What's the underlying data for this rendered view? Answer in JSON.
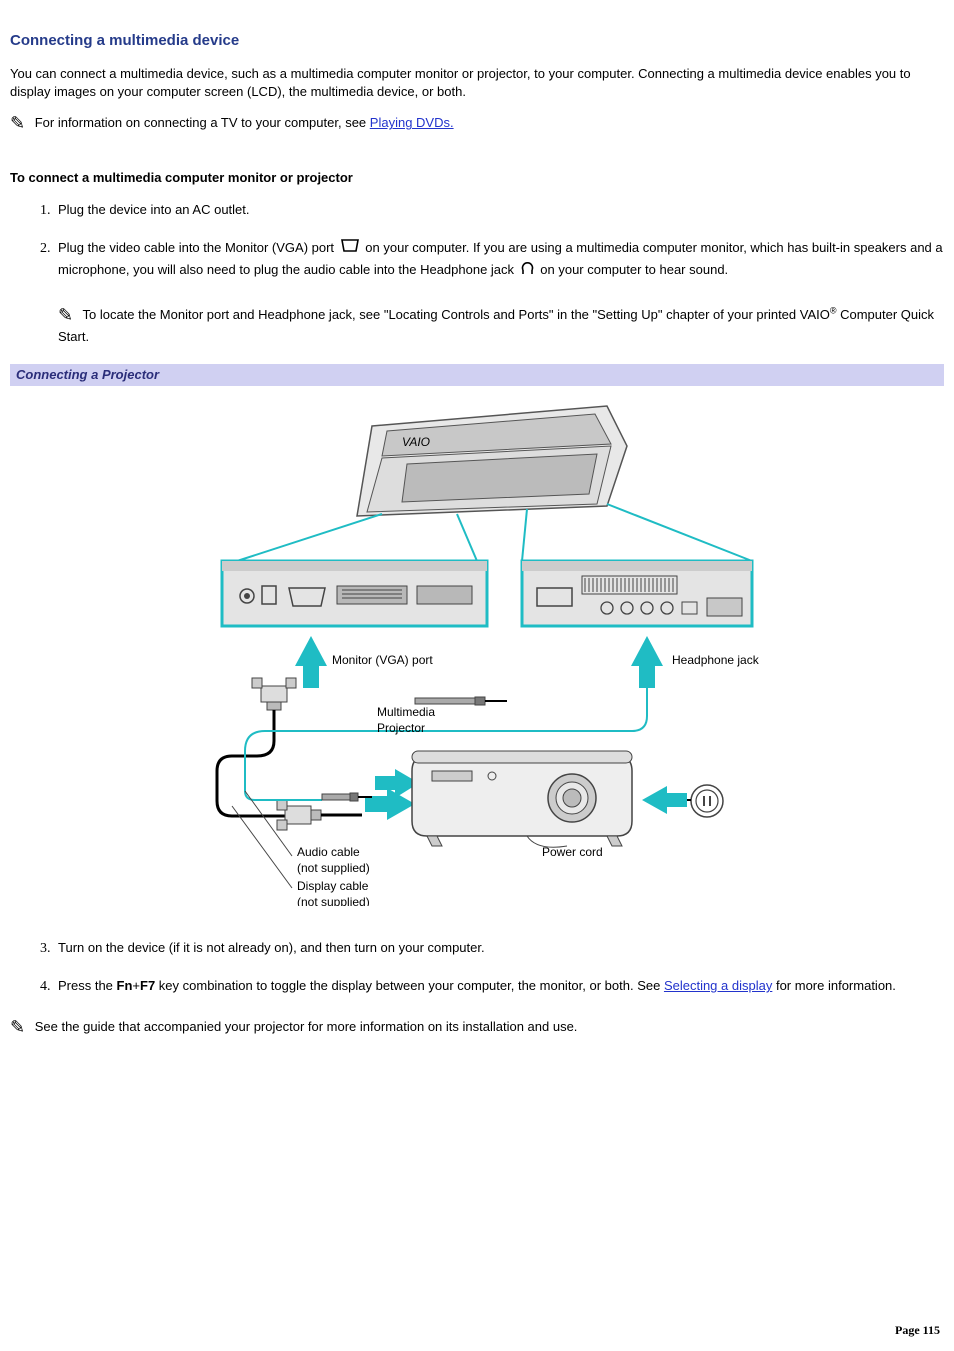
{
  "title": "Connecting a multimedia device",
  "intro": "You can connect a multimedia device, such as a multimedia computer monitor or projector, to your computer. Connecting a multimedia device enables you to display images on your computer screen (LCD), the multimedia device, or both.",
  "note_tv_prefix": "For information on connecting a TV to your computer, see ",
  "note_tv_link": "Playing DVDs.",
  "sub_heading": "To connect a multimedia computer monitor or projector",
  "steps": {
    "s1": "Plug the device into an AC outlet.",
    "s2_a": "Plug the video cable into the Monitor (VGA) port ",
    "s2_b": " on your computer. If you are using a multimedia computer monitor, which has built-in speakers and a microphone, you will also need to plug the audio cable into the Headphone jack ",
    "s2_c": " on your computer to hear sound.",
    "s2_note_a": "To locate the Monitor port and Headphone jack, see \"Locating Controls and Ports\" in the \"Setting Up\" chapter of your printed VAIO",
    "s2_note_b": " Computer Quick Start.",
    "s3": "Turn on the device (if it is not already on), and then turn on your computer.",
    "s4_a": "Press the ",
    "s4_key1": "Fn",
    "s4_plus": "+",
    "s4_key2": "F7",
    "s4_b": " key combination to toggle the display between your computer, the monitor, or both. See ",
    "s4_link": "Selecting a display",
    "s4_c": " for more information."
  },
  "figure_title": "Connecting a Projector",
  "figure_labels": {
    "vga_port": "Monitor (VGA) port",
    "headphone_jack": "Headphone jack",
    "multimedia_projector_1": "Multimedia",
    "multimedia_projector_2": "Projector",
    "power_cord": "Power cord",
    "audio_cable_1": "Audio cable",
    "audio_cable_2": "(not supplied)",
    "display_cable_1": "Display cable",
    "display_cable_2": "(not supplied)"
  },
  "closing_note": "See the guide that accompanied your projector for more information on its installation and use.",
  "page_number": "Page 115"
}
